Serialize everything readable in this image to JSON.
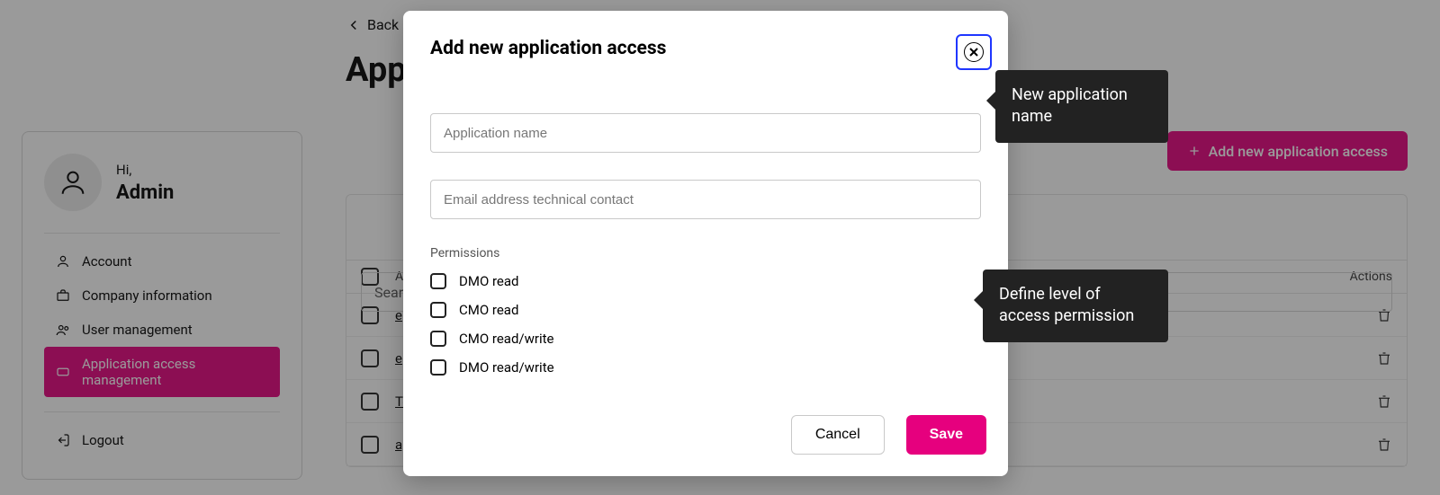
{
  "header": {
    "back_label": "Back",
    "page_title": "Appl"
  },
  "sidebar": {
    "hi": "Hi,",
    "username": "Admin",
    "items": [
      {
        "label": "Account"
      },
      {
        "label": "Company information"
      },
      {
        "label": "User management"
      },
      {
        "label": "Application access management"
      },
      {
        "label": "Logout"
      }
    ]
  },
  "main": {
    "add_button": "Add new application access",
    "search_placeholder": "Searc",
    "columns": {
      "name": "Ap",
      "actions": "Actions"
    },
    "rows": [
      {
        "label": "e"
      },
      {
        "label": "e"
      },
      {
        "label": "Te"
      },
      {
        "label": "ap"
      }
    ]
  },
  "modal": {
    "title": "Add new application access",
    "app_name_placeholder": "Application name",
    "email_placeholder": "Email address technical contact",
    "permissions_heading": "Permissions",
    "permissions": [
      "DMO read",
      "CMO read",
      "CMO read/write",
      "DMO read/write"
    ],
    "cancel": "Cancel",
    "save": "Save"
  },
  "tooltips": {
    "name_tip": "New application name",
    "perm_tip": "Define level of access permission"
  },
  "colors": {
    "accent": "#e6007e",
    "focus": "#1f36ff",
    "tooltip_bg": "#222222"
  }
}
